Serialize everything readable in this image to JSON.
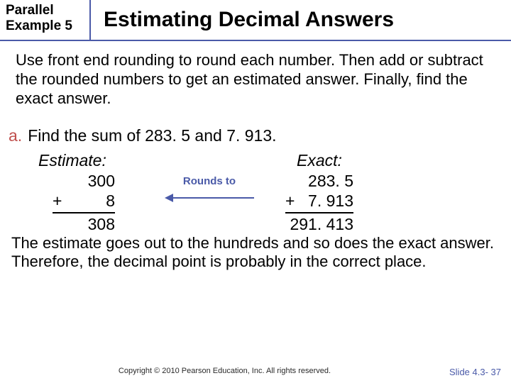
{
  "header": {
    "label_line1": "Parallel",
    "label_line2": "Example 5",
    "title": "Estimating Decimal Answers"
  },
  "instructions": "Use front end rounding to round each number. Then add or subtract the rounded numbers to get an estimated answer. Finally, find the exact answer.",
  "problem": {
    "marker": "a.",
    "text": "Find the sum of 283. 5 and 7. 913."
  },
  "estimate": {
    "heading": "Estimate:",
    "line1": "300",
    "operator": "+",
    "line2": "8",
    "result": "308"
  },
  "rounds_label": "Rounds to",
  "exact": {
    "heading": "Exact:",
    "line1": "283. 5",
    "operator": "+",
    "line2": "7. 913",
    "result": "291. 413"
  },
  "conclusion": "The estimate goes out to the hundreds and so does the exact answer. Therefore, the decimal point is probably in the correct place.",
  "footer": {
    "copyright": "Copyright © 2010 Pearson Education, Inc.  All rights reserved.",
    "slide": "Slide 4.3- 37"
  },
  "colors": {
    "rule_blue": "#4a5aa8",
    "marker_red": "#c0504d"
  }
}
